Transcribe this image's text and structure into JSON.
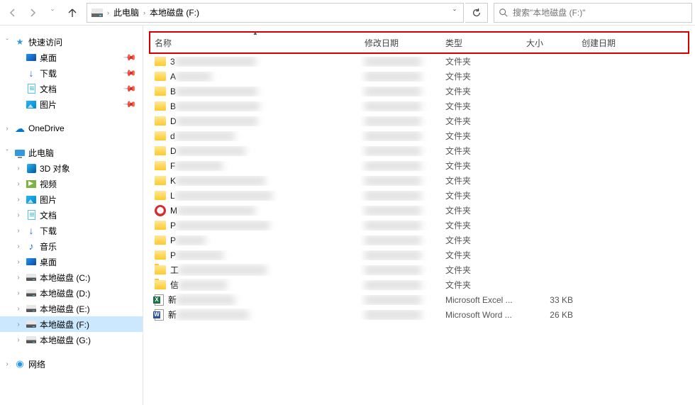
{
  "nav": {
    "dropdown_glyph": "ˇ"
  },
  "breadcrumb": {
    "root": "此电脑",
    "current": "本地磁盘 (F:)"
  },
  "search": {
    "placeholder": "搜索\"本地磁盘 (F:)\""
  },
  "sidebar": {
    "quick_access": "快速访问",
    "desktop": "桌面",
    "downloads": "下载",
    "documents": "文档",
    "pictures": "图片",
    "onedrive": "OneDrive",
    "this_pc": "此电脑",
    "objects_3d": "3D 对象",
    "videos": "视频",
    "pictures2": "图片",
    "documents2": "文档",
    "downloads2": "下载",
    "music": "音乐",
    "desktop2": "桌面",
    "drive_c": "本地磁盘 (C:)",
    "drive_d": "本地磁盘 (D:)",
    "drive_e": "本地磁盘 (E:)",
    "drive_f": "本地磁盘 (F:)",
    "drive_g": "本地磁盘 (G:)",
    "network": "网络"
  },
  "columns": {
    "name": "名称",
    "date": "修改日期",
    "type": "类型",
    "size": "大小",
    "created": "创建日期"
  },
  "type_labels": {
    "folder": "文件夹",
    "excel": "Microsoft Excel ...",
    "word": "Microsoft Word ..."
  },
  "files": [
    {
      "icon": "folder",
      "name": "3",
      "type": "folder",
      "size": ""
    },
    {
      "icon": "folder",
      "name": "A",
      "type": "folder",
      "size": ""
    },
    {
      "icon": "folder",
      "name": "B",
      "type": "folder",
      "size": ""
    },
    {
      "icon": "folder",
      "name": "B",
      "type": "folder",
      "size": ""
    },
    {
      "icon": "folder",
      "name": "D",
      "type": "folder",
      "size": ""
    },
    {
      "icon": "folder",
      "name": "d",
      "type": "folder",
      "size": ""
    },
    {
      "icon": "folder",
      "name": "D",
      "type": "folder",
      "size": ""
    },
    {
      "icon": "folder",
      "name": "F",
      "type": "folder",
      "size": ""
    },
    {
      "icon": "folder",
      "name": "K",
      "type": "folder",
      "size": ""
    },
    {
      "icon": "folder",
      "name": "L",
      "type": "folder",
      "size": ""
    },
    {
      "icon": "red",
      "name": "M",
      "type": "folder",
      "size": ""
    },
    {
      "icon": "folder",
      "name": "P",
      "type": "folder",
      "size": ""
    },
    {
      "icon": "folder",
      "name": "P",
      "type": "folder",
      "size": ""
    },
    {
      "icon": "folder",
      "name": "P",
      "type": "folder",
      "size": ""
    },
    {
      "icon": "folder",
      "name": "工",
      "type": "folder",
      "size": ""
    },
    {
      "icon": "folder",
      "name": "信",
      "type": "folder",
      "size": ""
    },
    {
      "icon": "excel",
      "name": "新",
      "type": "excel",
      "size": "33 KB"
    },
    {
      "icon": "word",
      "name": "新",
      "type": "word",
      "size": "26 KB"
    }
  ]
}
